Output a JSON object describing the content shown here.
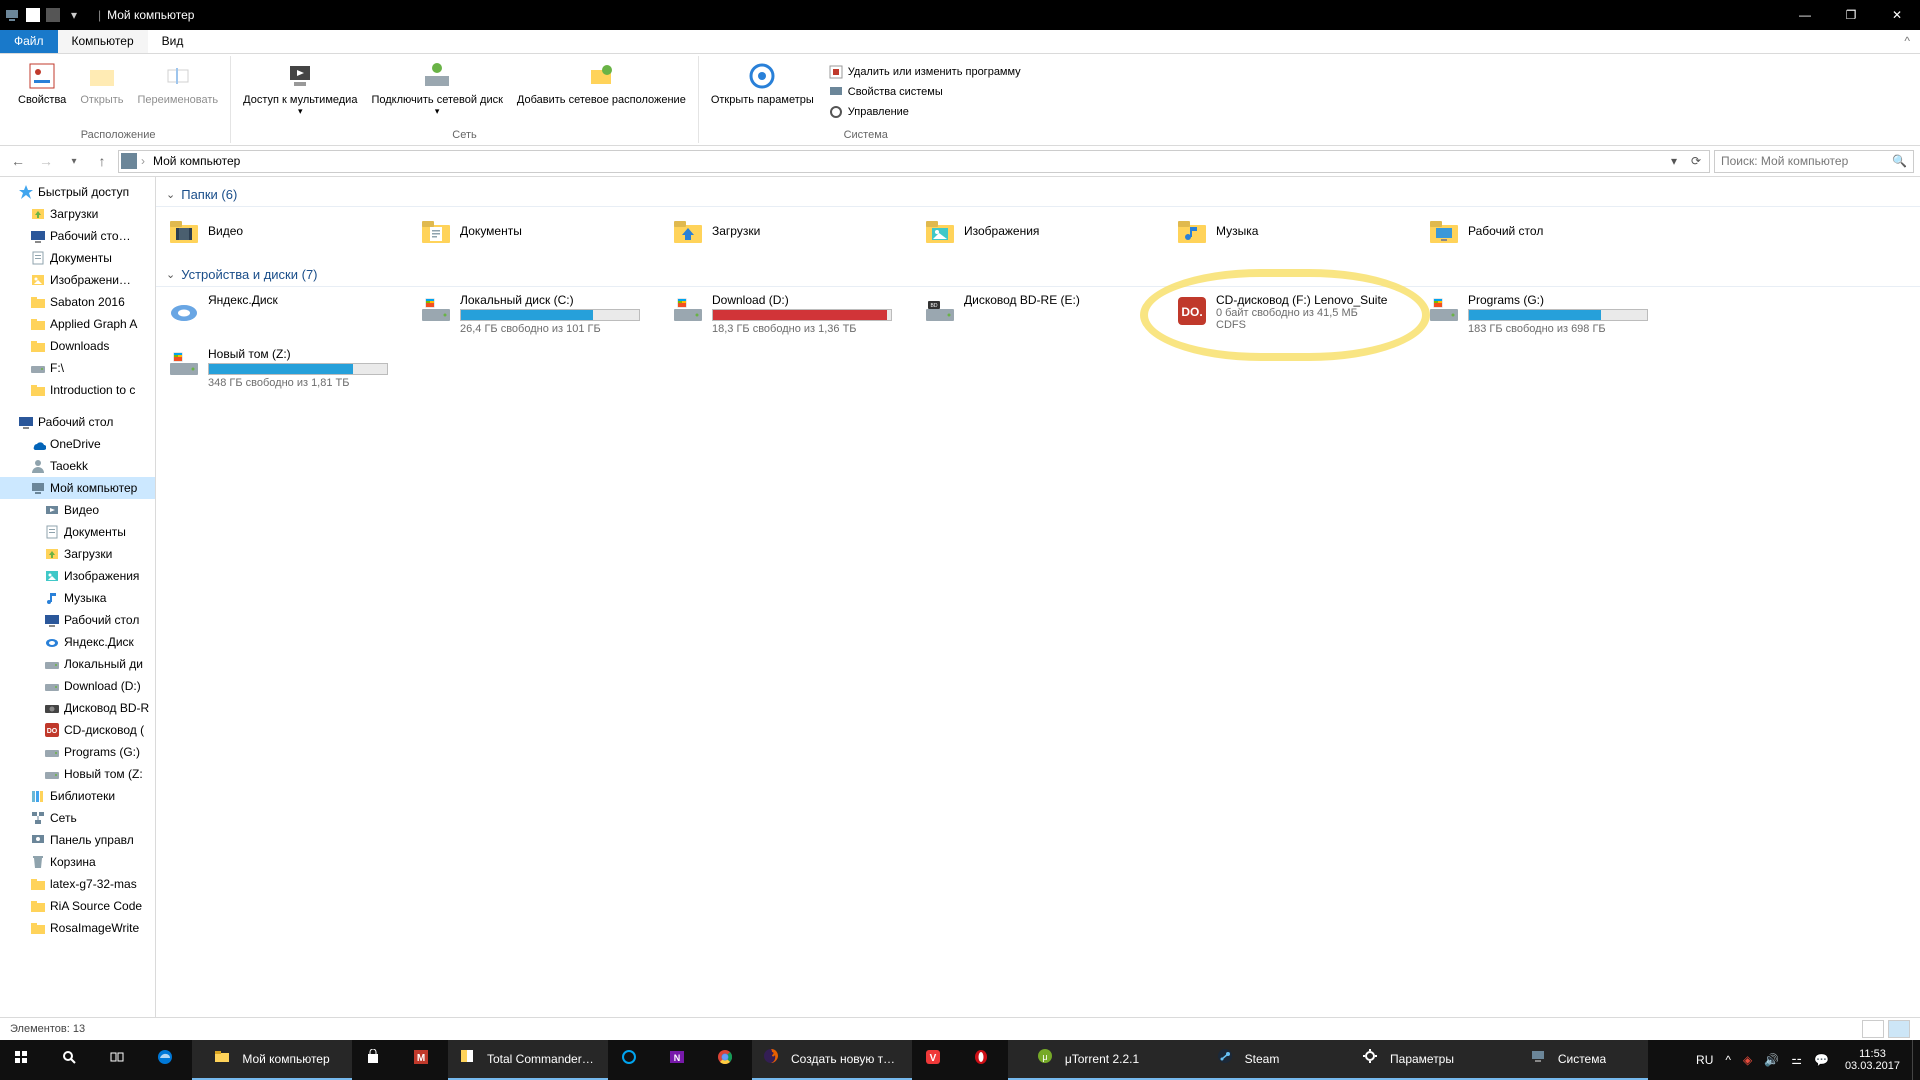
{
  "window": {
    "title": "Мой компьютер"
  },
  "tabs": {
    "file": "Файл",
    "computer": "Компьютер",
    "view": "Вид"
  },
  "ribbon": {
    "location": {
      "label": "Расположение",
      "properties": "Свойства",
      "open": "Открыть",
      "rename": "Переименовать"
    },
    "network": {
      "label": "Сеть",
      "media": "Доступ к\nмультимедиа",
      "netdrive": "Подключить\nсетевой диск",
      "netloc": "Добавить сетевое\nрасположение"
    },
    "system": {
      "label": "Система",
      "params": "Открыть\nпараметры",
      "uninstall": "Удалить или изменить программу",
      "sysprops": "Свойства системы",
      "manage": "Управление"
    }
  },
  "breadcrumb": "Мой компьютер",
  "search_placeholder": "Поиск: Мой компьютер",
  "nav": [
    {
      "l": 1,
      "ic": "star",
      "t": "Быстрый доступ",
      "c": "#41a5ee"
    },
    {
      "l": 2,
      "ic": "dl",
      "t": "Загрузки",
      "c": "#69b346"
    },
    {
      "l": 2,
      "ic": "desk",
      "t": "Рабочий сто…",
      "c": "#2b579a"
    },
    {
      "l": 2,
      "ic": "doc",
      "t": "Документы",
      "c": "#ffd35a"
    },
    {
      "l": 2,
      "ic": "img",
      "t": "Изображени…",
      "c": "#ffd35a"
    },
    {
      "l": 2,
      "ic": "fold",
      "t": "Sabaton 2016",
      "c": "#ffd35a"
    },
    {
      "l": 2,
      "ic": "fold",
      "t": "Applied Graph A",
      "c": "#ffd35a"
    },
    {
      "l": 2,
      "ic": "fold",
      "t": "Downloads",
      "c": "#ffd35a"
    },
    {
      "l": 2,
      "ic": "drive",
      "t": "F:\\",
      "c": "#9aa7b0"
    },
    {
      "l": 2,
      "ic": "fold",
      "t": "Introduction to c",
      "c": "#ffd35a"
    },
    {
      "l": 0,
      "spacer": true
    },
    {
      "l": 1,
      "ic": "desk",
      "t": "Рабочий стол",
      "c": "#2b579a"
    },
    {
      "l": 2,
      "ic": "od",
      "t": "OneDrive",
      "c": "#0364b8"
    },
    {
      "l": 2,
      "ic": "user",
      "t": "Taoekk",
      "c": "#8fa3ad"
    },
    {
      "l": 2,
      "ic": "pc",
      "t": "Мой компьютер",
      "c": "#6b8699",
      "sel": true
    },
    {
      "l": 3,
      "ic": "vid",
      "t": "Видео",
      "c": "#6b8699"
    },
    {
      "l": 3,
      "ic": "doc",
      "t": "Документы",
      "c": "#8fa3ad"
    },
    {
      "l": 3,
      "ic": "dl",
      "t": "Загрузки",
      "c": "#69b346"
    },
    {
      "l": 3,
      "ic": "img",
      "t": "Изображения",
      "c": "#40c8c8"
    },
    {
      "l": 3,
      "ic": "mus",
      "t": "Музыка",
      "c": "#2980d8"
    },
    {
      "l": 3,
      "ic": "desk",
      "t": "Рабочий стол",
      "c": "#2b579a"
    },
    {
      "l": 3,
      "ic": "yd",
      "t": "Яндекс.Диск",
      "c": "#2980d8"
    },
    {
      "l": 3,
      "ic": "drive",
      "t": "Локальный ди",
      "c": "#9aa7b0"
    },
    {
      "l": 3,
      "ic": "drive",
      "t": "Download (D:)",
      "c": "#9aa7b0"
    },
    {
      "l": 3,
      "ic": "bd",
      "t": "Дисковод BD-R",
      "c": "#444"
    },
    {
      "l": 3,
      "ic": "cd",
      "t": "CD-дисковод (",
      "c": "#c0392b"
    },
    {
      "l": 3,
      "ic": "drive",
      "t": "Programs (G:)",
      "c": "#9aa7b0"
    },
    {
      "l": 3,
      "ic": "drive",
      "t": "Новый том (Z:",
      "c": "#9aa7b0"
    },
    {
      "l": 2,
      "ic": "lib",
      "t": "Библиотеки",
      "c": "#6bb8d6"
    },
    {
      "l": 2,
      "ic": "net",
      "t": "Сеть",
      "c": "#6b8699"
    },
    {
      "l": 2,
      "ic": "cp",
      "t": "Панель управл",
      "c": "#6b8699"
    },
    {
      "l": 2,
      "ic": "bin",
      "t": "Корзина",
      "c": "#8fa3ad"
    },
    {
      "l": 2,
      "ic": "fold",
      "t": "latex-g7-32-mas",
      "c": "#ffd35a"
    },
    {
      "l": 2,
      "ic": "fold",
      "t": "RiA Source Code",
      "c": "#ffd35a"
    },
    {
      "l": 2,
      "ic": "fold",
      "t": "RosaImageWrite",
      "c": "#ffd35a"
    }
  ],
  "sections": {
    "folders": {
      "title": "Папки (6)",
      "items": [
        {
          "n": "Видео",
          "ic": "vid"
        },
        {
          "n": "Документы",
          "ic": "doc"
        },
        {
          "n": "Загрузки",
          "ic": "dl"
        },
        {
          "n": "Изображения",
          "ic": "img"
        },
        {
          "n": "Музыка",
          "ic": "mus"
        },
        {
          "n": "Рабочий стол",
          "ic": "desk"
        }
      ]
    },
    "devices": {
      "title": "Устройства и диски (7)",
      "items": [
        {
          "n": "Яндекс.Диск",
          "sub": "",
          "pct": null,
          "ic": "yd"
        },
        {
          "n": "Локальный диск (C:)",
          "sub": "26,4 ГБ свободно из 101 ГБ",
          "pct": 74,
          "ic": "drive"
        },
        {
          "n": "Download (D:)",
          "sub": "18,3 ГБ свободно из 1,36 ТБ",
          "pct": 98,
          "red": true,
          "ic": "drive"
        },
        {
          "n": "Дисковод BD-RE (E:)",
          "sub": "",
          "pct": null,
          "ic": "bd"
        },
        {
          "n": "CD-дисковод (F:) Lenovo_Suite",
          "sub": "0 байт свободно из 41,5 МБ",
          "sub2": "CDFS",
          "pct": null,
          "ic": "cd",
          "hl": true
        },
        {
          "n": "Programs (G:)",
          "sub": "183 ГБ свободно из 698 ГБ",
          "pct": 74,
          "ic": "drive"
        },
        {
          "n": "Новый том (Z:)",
          "sub": "348 ГБ свободно из 1,81 ТБ",
          "pct": 81,
          "ic": "drive"
        }
      ]
    }
  },
  "status": {
    "items": "Элементов: 13"
  },
  "taskbar": {
    "items": [
      {
        "ic": "win",
        "c": "#fff"
      },
      {
        "ic": "search",
        "c": "#fff"
      },
      {
        "ic": "taskview",
        "c": "#fff"
      },
      {
        "ic": "edge",
        "c": "#0078d7"
      },
      {
        "ic": "explorer",
        "c": "#ffd35a",
        "t": "Мой компьютер",
        "active": true
      },
      {
        "ic": "store",
        "c": "#fff"
      },
      {
        "ic": "mend",
        "c": "#c0392b"
      },
      {
        "ic": "tc",
        "c": "#ffd35a",
        "t": "Total Commander (…",
        "active": true
      },
      {
        "ic": "cortana",
        "c": "#00a4ef"
      },
      {
        "ic": "onenote",
        "c": "#7719aa"
      },
      {
        "ic": "chrome",
        "c": "#fff"
      },
      {
        "ic": "ff",
        "c": "#e66000",
        "t": "Создать новую те…",
        "active": true
      },
      {
        "ic": "viv",
        "c": "#ef3939"
      },
      {
        "ic": "opera",
        "c": "#cc0f16"
      },
      {
        "ic": "ut",
        "c": "#76a928",
        "t": "μTorrent 2.2.1",
        "active": true
      },
      {
        "ic": "steam",
        "c": "#66c0f4",
        "t": "Steam",
        "active": true
      },
      {
        "ic": "settings",
        "c": "#fff",
        "t": "Параметры",
        "active": true
      },
      {
        "ic": "sys",
        "c": "#6b8699",
        "t": "Система",
        "active": true
      }
    ],
    "tray": {
      "lang": "RU",
      "time": "11:53",
      "date": "03.03.2017"
    }
  }
}
